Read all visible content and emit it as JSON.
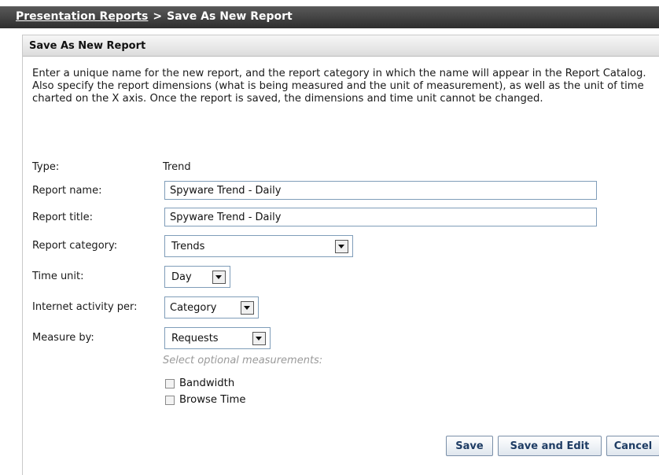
{
  "breadcrumb": {
    "link": "Presentation Reports",
    "separator": ">",
    "current": "Save As New Report"
  },
  "panel": {
    "title": "Save As New Report",
    "intro_line1": "Enter a unique name for the new report, and the report category in which the name will appear in the Report Catalog.",
    "intro_line2": "Also specify the report dimensions (what is being measured and the unit of measurement), as well as the unit of time charted on the X axis. Once the report is saved, the dimensions and time unit cannot be changed."
  },
  "form": {
    "type_label": "Type:",
    "type_value": "Trend",
    "report_name_label": "Report name:",
    "report_name_value": "Spyware Trend - Daily",
    "report_title_label": "Report title:",
    "report_title_value": "Spyware Trend - Daily",
    "report_category_label": "Report category:",
    "report_category_value": "Trends",
    "time_unit_label": "Time unit:",
    "time_unit_value": "Day",
    "activity_label": "Internet activity per:",
    "activity_value": "Category",
    "measure_label": "Measure by:",
    "measure_value": "Requests",
    "optional_hint": "Select optional measurements:",
    "option_bandwidth": "Bandwidth",
    "option_browse_time": "Browse Time"
  },
  "buttons": {
    "save": "Save",
    "save_and_edit": "Save and Edit",
    "cancel": "Cancel"
  },
  "colors": {
    "titlebar": "#3a3a3a",
    "button_text": "#1e3c64",
    "input_border": "#7f9db9"
  }
}
